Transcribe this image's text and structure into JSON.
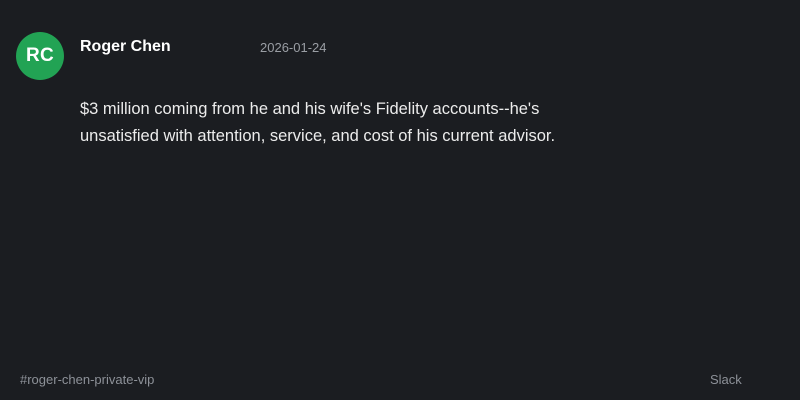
{
  "message": {
    "avatar_initials": "RC",
    "avatar_color": "#22a354",
    "author": "Roger Chen",
    "timestamp": "2026-01-24",
    "text": "$3 million coming from he and his wife's Fidelity accounts--he's unsatisfied with attention, service, and cost of his current advisor."
  },
  "footer": {
    "channel": "#roger-chen-private-vip",
    "source": "Slack"
  }
}
